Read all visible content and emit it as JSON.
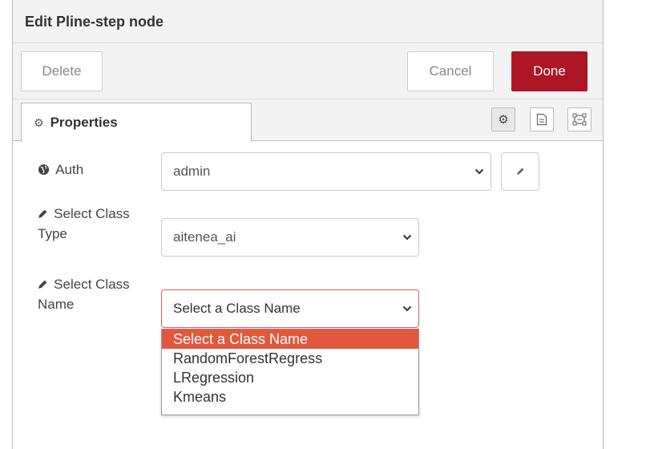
{
  "tray": {
    "title": "Edit Pline-step node"
  },
  "toolbar": {
    "delete_label": "Delete",
    "cancel_label": "Cancel",
    "done_label": "Done"
  },
  "tabs": {
    "properties_label": "Properties",
    "icons": [
      "gear-icon",
      "description-icon",
      "appearance-icon"
    ]
  },
  "form": {
    "auth": {
      "label": "Auth",
      "value": "admin"
    },
    "class_type": {
      "label_line1": "Select Class",
      "label_line2": "Type",
      "value": "aitenea_ai"
    },
    "class_name": {
      "label_line1": "Select Class",
      "label_line2": "Name",
      "value": "Select a Class Name",
      "options": [
        "Select a Class Name",
        "RandomForestRegress",
        "LRegression",
        "Kmeans"
      ]
    }
  },
  "colors": {
    "done_button": "#ad1625",
    "selected_option": "#e2583e",
    "focus_border": "#d6615a"
  }
}
